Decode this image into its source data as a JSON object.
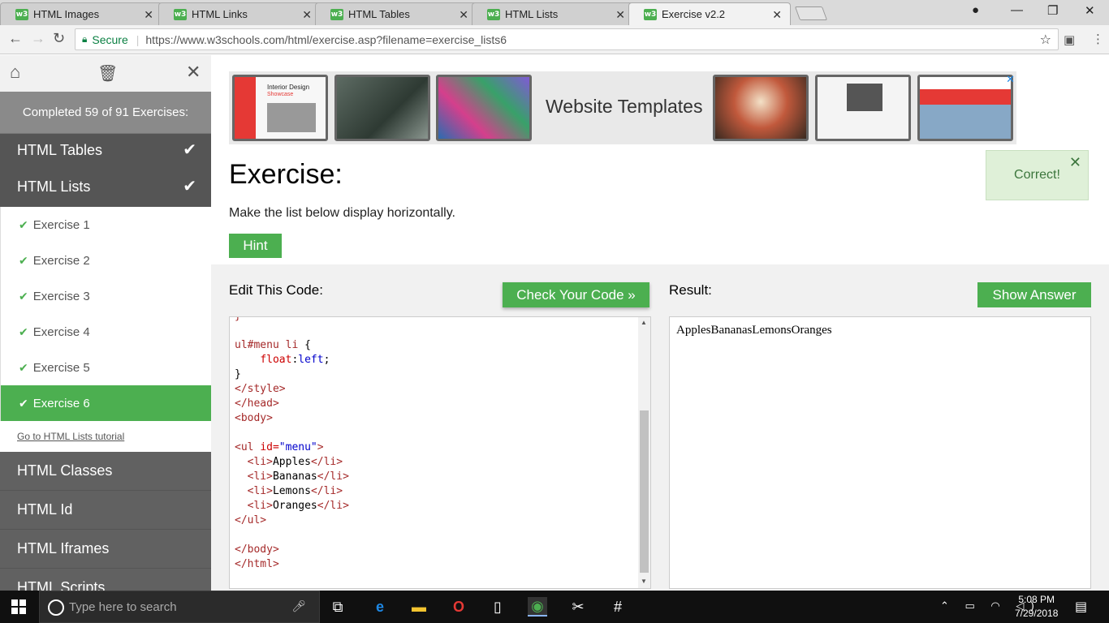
{
  "browser": {
    "tabs": [
      {
        "favicon": "w3",
        "title": "HTML Images"
      },
      {
        "favicon": "w3",
        "title": "HTML Links"
      },
      {
        "favicon": "w3",
        "title": "HTML Tables"
      },
      {
        "favicon": "w3",
        "title": "HTML Lists"
      },
      {
        "favicon": "w3",
        "title": "Exercise v2.2"
      }
    ],
    "security_label": "Secure",
    "url": "https://www.w3schools.com/html/exercise.asp?filename=exercise_lists6"
  },
  "sidebar": {
    "completed_text": "Completed 59 of 91 Exercises:",
    "sections_top": [
      {
        "label": "HTML Tables",
        "done": true
      },
      {
        "label": "HTML Lists",
        "done": true
      }
    ],
    "exercises": [
      {
        "label": "Exercise 1"
      },
      {
        "label": "Exercise 2"
      },
      {
        "label": "Exercise 3"
      },
      {
        "label": "Exercise 4"
      },
      {
        "label": "Exercise 5"
      },
      {
        "label": "Exercise 6"
      }
    ],
    "tutorial_link": "Go to HTML Lists tutorial",
    "sections_bottom": [
      {
        "label": "HTML Classes"
      },
      {
        "label": "HTML Id"
      },
      {
        "label": "HTML Iframes"
      },
      {
        "label": "HTML Scripts"
      }
    ]
  },
  "ad": {
    "text": "Website Templates",
    "thumb1_title": "Interior Design",
    "thumb1_sub": "Showcase"
  },
  "exercise": {
    "title": "Exercise:",
    "description": "Make the list below display horizontally.",
    "hint_label": "Hint",
    "correct_label": "Correct!"
  },
  "workspace": {
    "edit_label": "Edit This Code:",
    "check_label": "Check Your Code »",
    "result_label": "Result:",
    "answer_label": "Show Answer",
    "result_text": "ApplesBananasLemonsOranges"
  },
  "taskbar": {
    "search_placeholder": "Type here to search",
    "time": "5:08 PM",
    "date": "7/29/2018"
  },
  "colors": {
    "accent": "#4caf50",
    "sidebar_bg": "#616161"
  }
}
